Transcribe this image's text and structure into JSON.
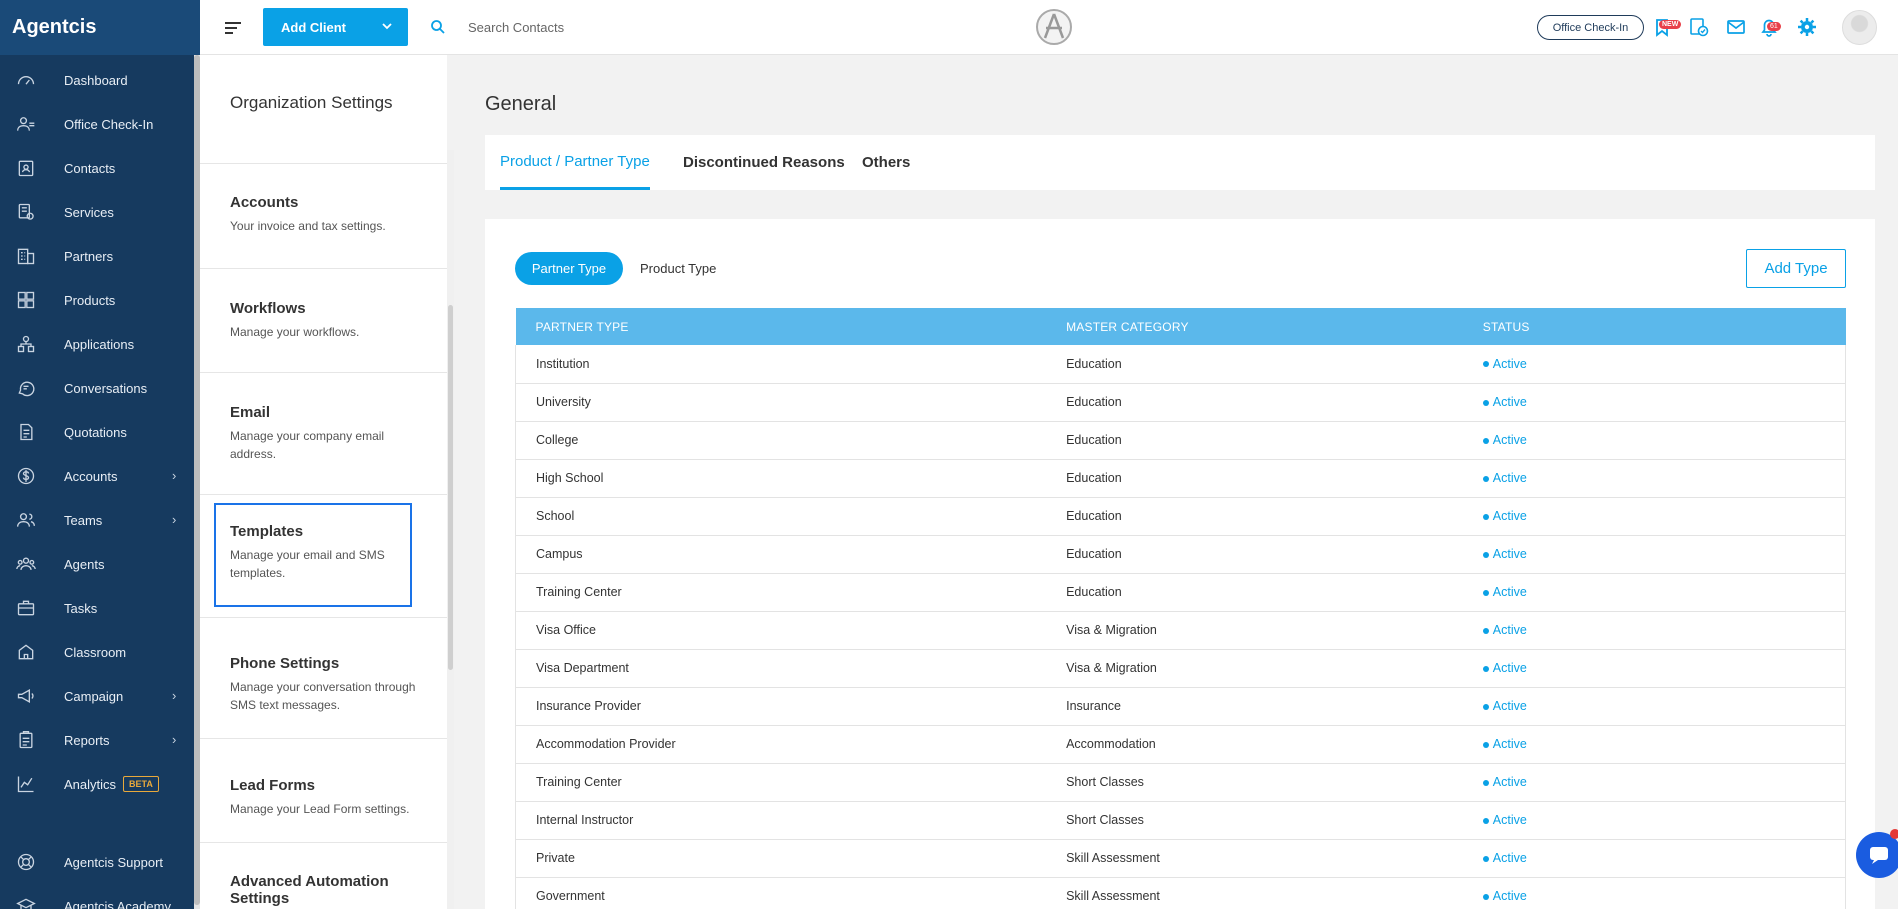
{
  "brand": "Agentcis",
  "sidebar": {
    "items": [
      {
        "label": "Dashboard",
        "icon": "gauge-icon"
      },
      {
        "label": "Office Check-In",
        "icon": "user-checkin-icon"
      },
      {
        "label": "Contacts",
        "icon": "contact-card-icon"
      },
      {
        "label": "Services",
        "icon": "services-icon"
      },
      {
        "label": "Partners",
        "icon": "building-icon"
      },
      {
        "label": "Products",
        "icon": "products-icon"
      },
      {
        "label": "Applications",
        "icon": "flow-icon"
      },
      {
        "label": "Conversations",
        "icon": "chat-icon"
      },
      {
        "label": "Quotations",
        "icon": "document-icon"
      },
      {
        "label": "Accounts",
        "icon": "dollar-icon"
      },
      {
        "label": "Teams",
        "icon": "team-icon"
      },
      {
        "label": "Agents",
        "icon": "agents-icon"
      },
      {
        "label": "Tasks",
        "icon": "briefcase-icon"
      },
      {
        "label": "Classroom",
        "icon": "classroom-icon"
      },
      {
        "label": "Campaign",
        "icon": "megaphone-icon"
      },
      {
        "label": "Reports",
        "icon": "clipboard-icon"
      },
      {
        "label": "Analytics",
        "icon": "chart-icon"
      }
    ],
    "beta_label": "BETA",
    "support": [
      {
        "label": "Agentcis Support",
        "icon": "support-icon"
      },
      {
        "label": "Agentcis Academy",
        "icon": "academy-icon"
      }
    ]
  },
  "topbar": {
    "add_client_label": "Add Client",
    "search_placeholder": "Search Contacts",
    "checkin_label": "Office Check-In",
    "new_badge": "NEW",
    "notification_count": "61"
  },
  "settings": {
    "title": "Organization Settings",
    "items": [
      {
        "title": "Accounts",
        "desc": "Your invoice and tax settings."
      },
      {
        "title": "Workflows",
        "desc": "Manage your workflows."
      },
      {
        "title": "Email",
        "desc": "Manage your company email address."
      },
      {
        "title": "Templates",
        "desc": "Manage your email and SMS templates."
      },
      {
        "title": "Phone Settings",
        "desc": "Manage your conversation through SMS text messages."
      },
      {
        "title": "Lead Forms",
        "desc": "Manage your Lead Form settings."
      },
      {
        "title": "Advanced Automation Settings",
        "desc": ""
      }
    ]
  },
  "main": {
    "title": "General",
    "tabs": [
      "Product / Partner Type",
      "Discontinued Reasons",
      "Others"
    ],
    "pills": [
      "Partner Type",
      "Product Type"
    ],
    "add_type_label": "Add Type",
    "columns": [
      "PARTNER TYPE",
      "MASTER CATEGORY",
      "STATUS"
    ],
    "rows": [
      [
        "Institution",
        "Education",
        "Active"
      ],
      [
        "University",
        "Education",
        "Active"
      ],
      [
        "College",
        "Education",
        "Active"
      ],
      [
        "High School",
        "Education",
        "Active"
      ],
      [
        "School",
        "Education",
        "Active"
      ],
      [
        "Campus",
        "Education",
        "Active"
      ],
      [
        "Training Center",
        "Education",
        "Active"
      ],
      [
        "Visa Office",
        "Visa & Migration",
        "Active"
      ],
      [
        "Visa Department",
        "Visa & Migration",
        "Active"
      ],
      [
        "Insurance Provider",
        "Insurance",
        "Active"
      ],
      [
        "Accommodation Provider",
        "Accommodation",
        "Active"
      ],
      [
        "Training Center",
        "Short Classes",
        "Active"
      ],
      [
        "Internal Instructor",
        "Short Classes",
        "Active"
      ],
      [
        "Private",
        "Skill Assessment",
        "Active"
      ],
      [
        "Government",
        "Skill Assessment",
        "Active"
      ]
    ]
  },
  "colors": {
    "accent": "#0aa1e6",
    "sidebar": "#163a5f",
    "table_header": "#5bb8eb"
  }
}
